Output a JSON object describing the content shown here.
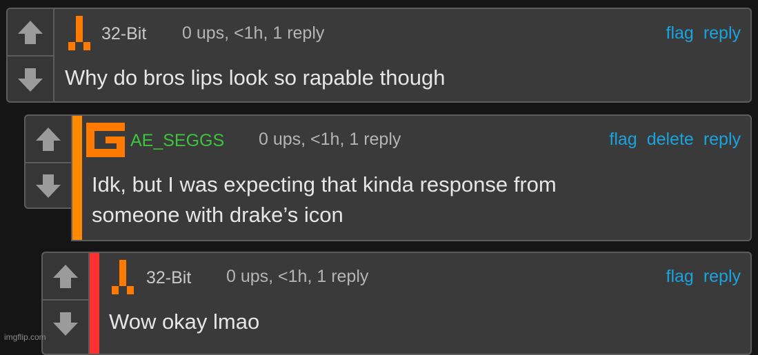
{
  "comments": [
    {
      "username": "32-Bit",
      "username_color": "#c9c9c9",
      "meta": "0 ups, <1h, 1 reply",
      "actions": [
        "flag",
        "reply"
      ],
      "text": "Why do bros lips look so rapable though",
      "avatar_icon": "pixel-tower-icon",
      "avatar_color": "#ff7a00"
    },
    {
      "username": "AE_SEGGS",
      "username_color": "#3cc43c",
      "meta": "0 ups, <1h, 1 reply",
      "actions": [
        "flag",
        "delete",
        "reply"
      ],
      "text": "Idk, but I was expecting that kinda response from\nsomeone with drake’s icon",
      "avatar_icon": "pixel-g-icon",
      "avatar_color": "#ff7a00",
      "accent_color": "#ff8a00"
    },
    {
      "username": "32-Bit",
      "username_color": "#c9c9c9",
      "meta": "0 ups, <1h, 1 reply",
      "actions": [
        "flag",
        "reply"
      ],
      "text": "Wow okay lmao",
      "avatar_icon": "pixel-tower-icon",
      "avatar_color": "#ff7a00",
      "accent_color": "#ff3030"
    }
  ],
  "icons": {
    "upvote": "arrow-up-icon",
    "downvote": "arrow-down-icon"
  },
  "colors": {
    "link": "#1aa3dd",
    "background": "#151515",
    "card": "#3a3a3a"
  },
  "watermark": "imgflip.com"
}
